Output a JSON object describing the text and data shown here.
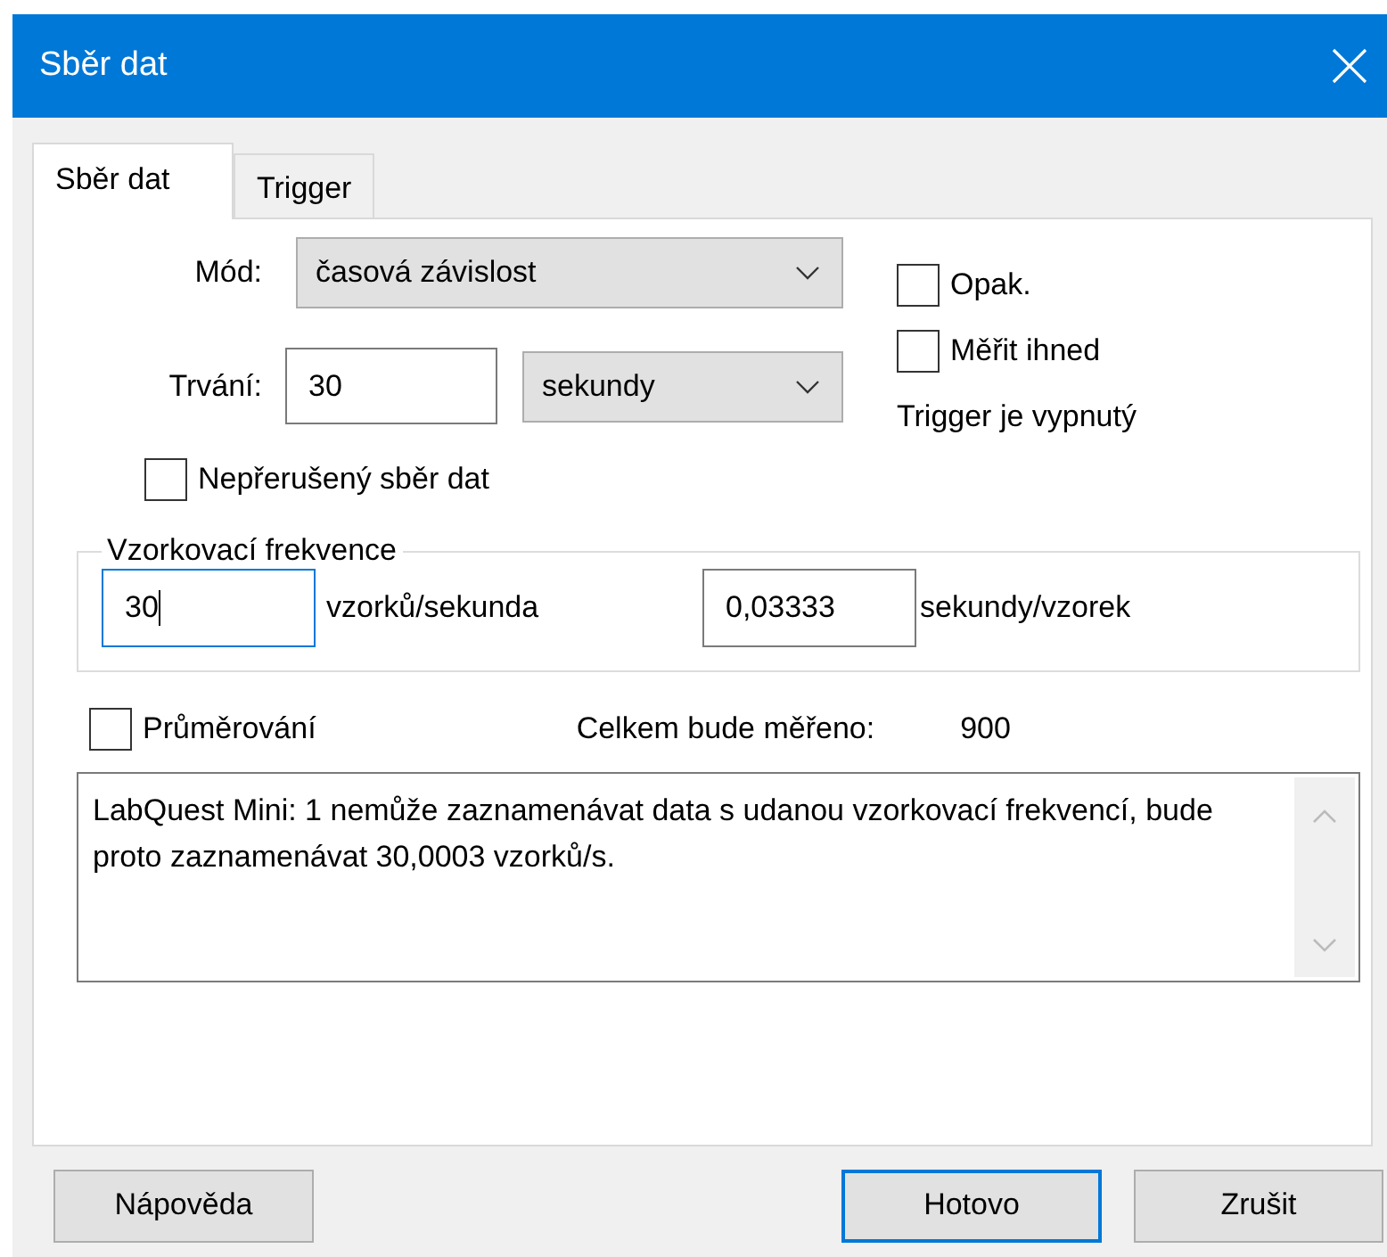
{
  "window": {
    "title": "Sběr dat"
  },
  "tabs": [
    {
      "label": "Sběr dat",
      "selected": true
    },
    {
      "label": "Trigger",
      "selected": false
    }
  ],
  "mode": {
    "label": "Mód:",
    "value": "časová závislost"
  },
  "duration": {
    "label": "Trvání:",
    "value": "30",
    "unit": "sekundy"
  },
  "continuous": {
    "label": "Nepřerušený sběr dat",
    "checked": false
  },
  "repeat": {
    "label": "Opak.",
    "checked": false
  },
  "measure_now": {
    "label": "Měřit ihned",
    "checked": false
  },
  "trigger_status": "Trigger je vypnutý",
  "sampling": {
    "title": "Vzorkovací frekvence",
    "rate": {
      "value": "30",
      "unit": "vzorků/sekunda",
      "focused": true
    },
    "interval": {
      "value": "0,03333",
      "unit": "sekundy/vzorek",
      "focused": false
    }
  },
  "averaging": {
    "label": "Průměrování",
    "checked": false
  },
  "total": {
    "label": "Celkem bude měřeno:",
    "value": "900"
  },
  "message": "LabQuest Mini: 1 nemůže zaznamenávat data s udanou vzorkovací frekvencí, bude proto zaznamenávat 30,0003 vzorků/s.",
  "buttons": [
    {
      "label": "Nápověda",
      "default": false
    },
    {
      "label": "Hotovo",
      "default": true
    },
    {
      "label": "Zrušit",
      "default": false
    }
  ]
}
